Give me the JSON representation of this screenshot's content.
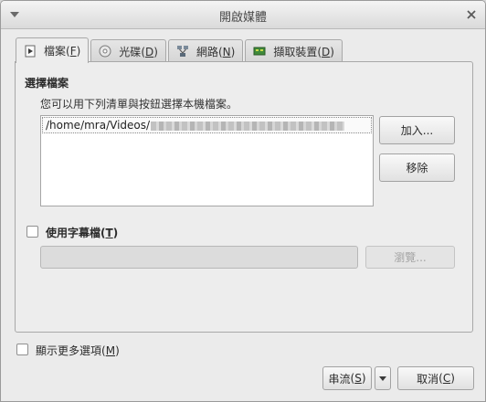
{
  "window": {
    "title": "開啟媒體"
  },
  "tabs": [
    {
      "label": "檔案",
      "mnemonic": "F",
      "icon": "file-icon",
      "active": true
    },
    {
      "label": "光碟",
      "mnemonic": "D",
      "icon": "disc-icon",
      "active": false
    },
    {
      "label": "網路",
      "mnemonic": "N",
      "icon": "network-icon",
      "active": false
    },
    {
      "label": "擷取裝置",
      "mnemonic": "D",
      "icon": "capture-card-icon",
      "active": false
    }
  ],
  "file_selection": {
    "group_title": "選擇檔案",
    "help_text": "您可以用下列清單與按鈕選擇本機檔案。",
    "files": [
      {
        "path": "/home/mra/Videos/"
      }
    ],
    "add_button": "加入...",
    "remove_button": "移除"
  },
  "subtitle": {
    "checkbox_label": "使用字幕檔",
    "checkbox_mnemonic": "T",
    "checked": false,
    "path_value": "",
    "browse_button": "瀏覽..."
  },
  "more_options": {
    "label": "顯示更多選項",
    "mnemonic": "M",
    "checked": false
  },
  "footer": {
    "stream_button": "串流",
    "stream_mnemonic": "S",
    "cancel_button": "取消",
    "cancel_mnemonic": "C"
  }
}
